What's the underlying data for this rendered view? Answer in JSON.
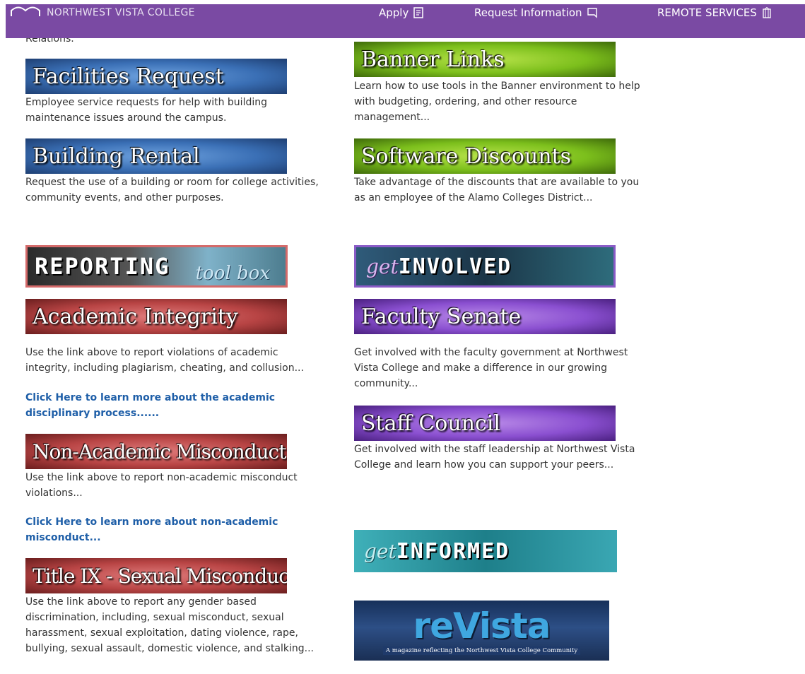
{
  "header": {
    "college_name": "NORTHWEST VISTA COLLEGE",
    "nav": [
      {
        "label": "Apply",
        "icon": "form-icon"
      },
      {
        "label": "Request Information",
        "icon": "bookmark-icon"
      },
      {
        "label": "REMOTE SERVICES",
        "icon": "building-icon"
      }
    ]
  },
  "cut_text": "Relations.",
  "left": {
    "facilities": {
      "title": "Facilities Request",
      "desc": "Employee service requests for help with building maintenance issues around the campus."
    },
    "building": {
      "title": "Building Rental",
      "desc": "Request the use of a building or room for college activities, community events, and other purposes."
    },
    "reporting": {
      "word1": "REPORTING",
      "word2": "tool box"
    },
    "academic": {
      "title": "Academic Integrity",
      "desc": "Use the link above to report violations of academic integrity, including plagiarism, cheating, and collusion...",
      "link": "Click Here to learn more about the academic disciplinary process......"
    },
    "nonacademic": {
      "title": "Non-Academic Misconduct",
      "desc": "Use the link above to report non-academic misconduct violations...",
      "link": "Click Here to learn more about non-academic misconduct..."
    },
    "titleix": {
      "title": "Title IX - Sexual Misconduct",
      "desc": "Use the link above to report any gender based discrimination, including, sexual misconduct, sexual harassment, sexual exploitation, dating violence, rape, bullying, sexual assault, domestic violence, and stalking..."
    }
  },
  "right": {
    "banner": {
      "title": "Banner Links",
      "desc": "Learn how to use tools in the Banner environment to help with budgeting, ordering, and other resource management..."
    },
    "software": {
      "title": "Software Discounts",
      "desc": "Take advantage of the discounts that are available to you as an employee of the Alamo Colleges District..."
    },
    "involved": {
      "get": "get",
      "word": "INVOLVED"
    },
    "senate": {
      "title": "Faculty Senate",
      "desc": "Get involved with the faculty government at Northwest Vista College and make a difference in our growing community..."
    },
    "staff": {
      "title": "Staff Council",
      "desc": "Get involved with the staff leadership at Northwest Vista College and learn how you can support your peers..."
    },
    "informed": {
      "get": "get",
      "word": "INFORMED"
    },
    "revista": {
      "title": "reVista",
      "tagline": "A magazine reflecting the Northwest Vista College Community"
    }
  }
}
